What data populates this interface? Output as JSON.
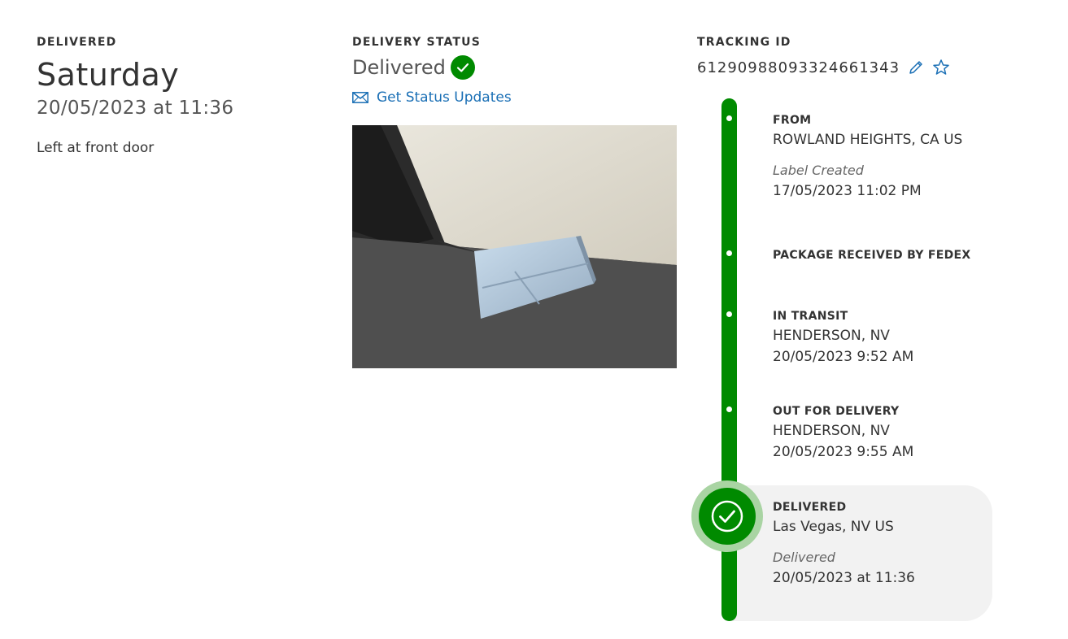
{
  "summary": {
    "label": "DELIVERED",
    "day": "Saturday",
    "datetime": "20/05/2023 at 11:36",
    "note": "Left at front door"
  },
  "status": {
    "label": "DELIVERY STATUS",
    "value": "Delivered",
    "updates_link": "Get Status Updates"
  },
  "tracking": {
    "label": "TRACKING ID",
    "id": "612909880933246613​43"
  },
  "timeline": {
    "from": {
      "title": "FROM",
      "location": "ROWLAND HEIGHTS, CA US",
      "event": "Label Created",
      "date": "17/05/2023 11:02 PM"
    },
    "received": {
      "title": "PACKAGE RECEIVED BY FEDEX"
    },
    "transit": {
      "title": "IN TRANSIT",
      "location": "HENDERSON, NV",
      "date": "20/05/2023 9:52 AM"
    },
    "out": {
      "title": "OUT FOR DELIVERY",
      "location": "HENDERSON, NV",
      "date": "20/05/2023 9:55 AM"
    },
    "delivered": {
      "title": "DELIVERED",
      "location": "Las Vegas, NV US",
      "event": "Delivered",
      "date": "20/05/2023 at 11:36"
    }
  },
  "colors": {
    "accent_green": "#008a00",
    "link_blue": "#1a6fb5",
    "panel_gray": "#f2f2f2"
  },
  "icons": [
    "check-icon",
    "mail-icon",
    "pencil-icon",
    "star-icon"
  ]
}
